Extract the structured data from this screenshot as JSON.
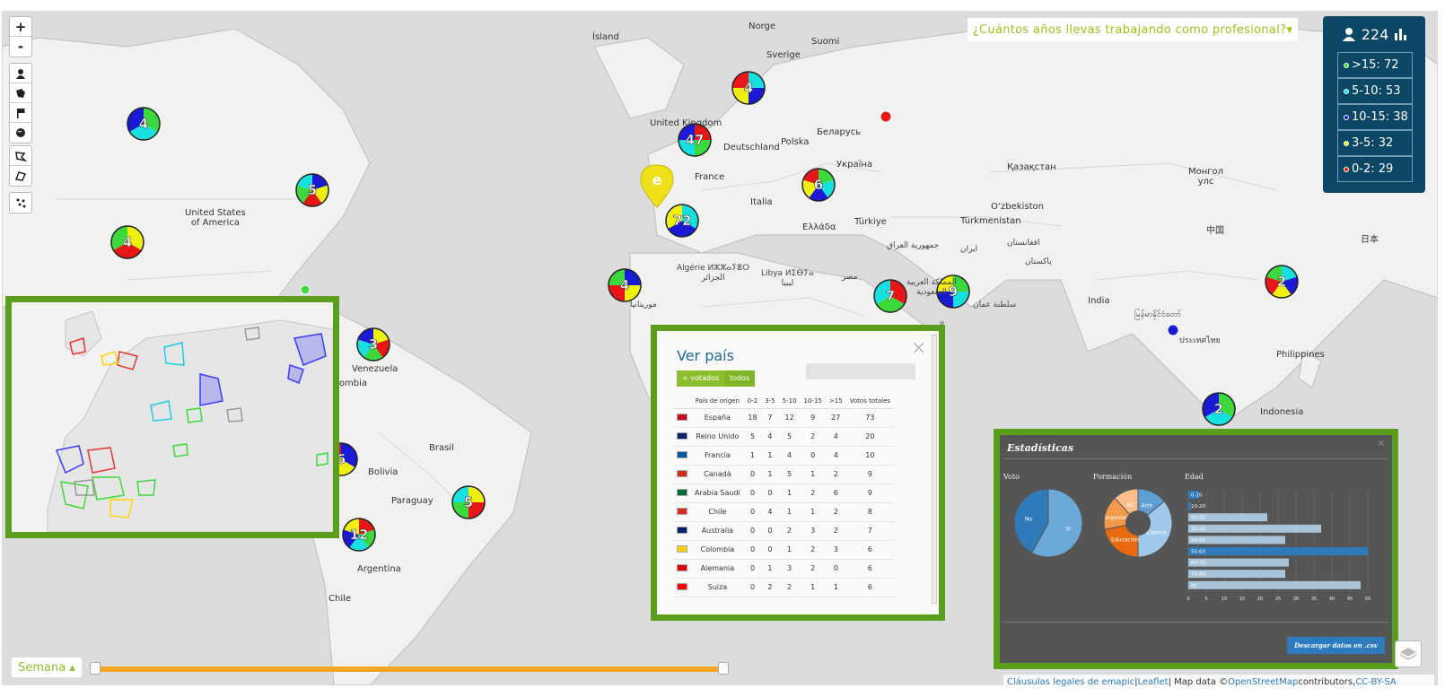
{
  "map": {
    "labels": {
      "island": "Ísland",
      "norge": "Norge",
      "sverige": "Sverige",
      "suomi": "Suomi",
      "uk": "United Kingdom",
      "deutschland": "Deutschland",
      "polska": "Polska",
      "belarus": "Беларусь",
      "ukraina": "Україна",
      "france": "France",
      "italia": "Italia",
      "kazakhstan": "Қазақстан",
      "mongol": "Монгол\nулс",
      "uzbekiston": "O‘zbekiston",
      "turkmenistan": "Türkmenistan",
      "turkiye": "Türkiye",
      "ellada": "Ελλάδα",
      "china": "中国",
      "japan": "日本",
      "iraq": "جمهورية العراق",
      "iran": "ایران",
      "afghanistan": "افغانستان",
      "pakistan": "پاکستان",
      "india": "India",
      "myanmar": "မြန်မာနိုင်ငံတော်",
      "thailand": "ประเทศไทย",
      "philippines": "Philippines",
      "indonesia": "Indonesia",
      "algerie": "Algérie ⵍⵣⵣⴰⵢⴻⵔ\nالجزائر",
      "libya": "Libya ⵍⵉⴱⵢⴰ\nليبيا",
      "misr": "مصر",
      "mauritania": "موريتانيا",
      "saudi": "المملكة العربية\nالسعودية",
      "yemen": "اليمن",
      "oman": "سلطنة عمان",
      "usa": "United States\nof America",
      "venezuela": "Venezuela",
      "colombia": "Colombia",
      "brasil": "Brasil",
      "bolivia": "Bolivia",
      "paraguay": "Paraguay",
      "argentina": "Argentina",
      "chile": "Chile"
    },
    "clusters": [
      "4",
      "4",
      "5",
      "4",
      "47",
      "6",
      "72",
      "4",
      "3",
      "7",
      "9",
      "2",
      "6",
      "5",
      "12",
      "2"
    ]
  },
  "zoom": {
    "in": "+",
    "out": "-"
  },
  "question": {
    "label": "¿Cuántos años llevas trabajando como profesional?▾"
  },
  "legend": {
    "total": "224",
    "items": [
      {
        "label": ">15: 72",
        "color": "#3bd93b"
      },
      {
        "label": "5-10: 53",
        "color": "#16e0e0"
      },
      {
        "label": "10-15: 38",
        "color": "#1a1ad6"
      },
      {
        "label": "3-5: 32",
        "color": "#f0f00f"
      },
      {
        "label": "0-2: 29",
        "color": "#e81616"
      }
    ]
  },
  "verpais": {
    "title": "Ver país",
    "btn_votados": "+ votados",
    "btn_todos": "todos",
    "close": "×",
    "headers": [
      "",
      "País de origen",
      "0-2",
      "3-5",
      "5-10",
      "10-15",
      ">15",
      "Votos totales"
    ],
    "rows": [
      {
        "flag": "#c60b1e",
        "name": "España",
        "v": [
          "18",
          "7",
          "12",
          "9",
          "27",
          "73"
        ]
      },
      {
        "flag": "#012169",
        "name": "Reino Unido",
        "v": [
          "5",
          "4",
          "5",
          "2",
          "4",
          "20"
        ]
      },
      {
        "flag": "#0055a4",
        "name": "Francia",
        "v": [
          "1",
          "1",
          "4",
          "0",
          "4",
          "10"
        ]
      },
      {
        "flag": "#d52b1e",
        "name": "Canadá",
        "v": [
          "0",
          "1",
          "5",
          "1",
          "2",
          "9"
        ]
      },
      {
        "flag": "#006c35",
        "name": "Arabia Saudí",
        "v": [
          "0",
          "0",
          "1",
          "2",
          "6",
          "9"
        ]
      },
      {
        "flag": "#d52b1e",
        "name": "Chile",
        "v": [
          "0",
          "4",
          "1",
          "1",
          "2",
          "8"
        ]
      },
      {
        "flag": "#012169",
        "name": "Australia",
        "v": [
          "0",
          "0",
          "2",
          "3",
          "2",
          "7"
        ]
      },
      {
        "flag": "#fcd116",
        "name": "Colombia",
        "v": [
          "0",
          "0",
          "1",
          "2",
          "3",
          "6"
        ]
      },
      {
        "flag": "#dd0000",
        "name": "Alemania",
        "v": [
          "0",
          "1",
          "3",
          "2",
          "0",
          "6"
        ]
      },
      {
        "flag": "#ff0000",
        "name": "Suiza",
        "v": [
          "0",
          "2",
          "2",
          "1",
          "1",
          "6"
        ]
      }
    ]
  },
  "stats": {
    "title": "Estadísticas",
    "close": "×",
    "voto_label": "Voto",
    "formacion_label": "Formación",
    "edad_label": "Edad",
    "download": "Descargar datos en .csv",
    "voto": [
      {
        "label": "Sí",
        "value": 58,
        "color": "#6aa9d8"
      },
      {
        "label": "No",
        "value": 42,
        "color": "#2f7ab8"
      }
    ],
    "formacion": [
      {
        "label": "Arte",
        "value": 14,
        "color": "#5d9fd4"
      },
      {
        "label": "Ciencia",
        "value": 36,
        "color": "#9fc9ea"
      },
      {
        "label": "Educación",
        "value": 22,
        "color": "#e86a10"
      },
      {
        "label": "Ingeniería",
        "value": 16,
        "color": "#f29a4a"
      },
      {
        "label": "NC",
        "value": 12,
        "color": "#f9c08e"
      }
    ],
    "edad": {
      "categories": [
        "0-10",
        "10-20",
        "20-30",
        "30-40",
        "40-50",
        "50-60",
        "60-70",
        "70-80",
        "NC"
      ],
      "values": [
        3,
        0,
        22,
        37,
        27,
        50,
        28,
        27,
        48
      ],
      "ticks": [
        "0",
        "5",
        "10",
        "15",
        "20",
        "25",
        "30",
        "35",
        "40",
        "45",
        "50"
      ]
    }
  },
  "timeline": {
    "label": "Semana ▴"
  },
  "attribution": {
    "legal": "Cláusulas legales de emapic",
    "sep1": " | ",
    "leaflet": "Leaflet",
    "mapdata": " | Map data © ",
    "osm": "OpenStreetMap",
    "contrib": " contributors, ",
    "license": "CC-BY-SA"
  }
}
